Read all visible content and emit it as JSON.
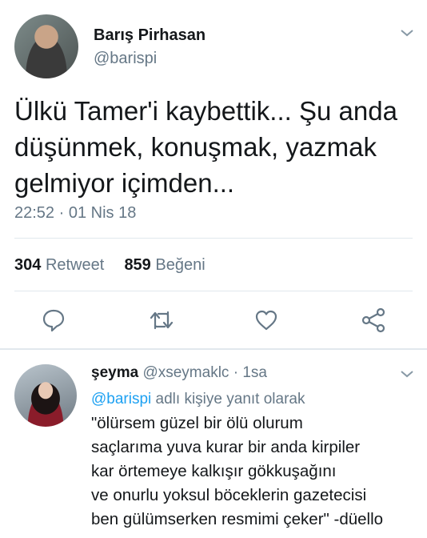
{
  "tweet": {
    "author_name": "Barış Pirhasan",
    "author_handle": "@barispi",
    "text_lines": [
      "Ülkü Tamer'i kaybettik... Şu anda",
      "düşünmek, konuşmak, yazmak",
      "gelmiyor içimden..."
    ],
    "time": "22:52",
    "separator": "·",
    "date": "01 Nis 18",
    "retweet_count": "304",
    "retweet_label": "Retweet",
    "like_count": "859",
    "like_label": "Beğeni"
  },
  "actions": [
    "reply-icon",
    "retweet-icon",
    "like-icon",
    "share-icon"
  ],
  "reply": {
    "author_name": "şeyma",
    "author_handle": "@xseymaklc",
    "separator": "·",
    "age": "1sa",
    "mention": "@barispi",
    "replying_suffix": "adlı kişiye yanıt olarak",
    "text_lines": [
      "\"ölürsem güzel bir ölü olurum",
      "saçlarıma yuva kurar bir anda kirpiler",
      "kar örtemeye kalkışır gökkuşağını",
      "ve onurlu yoksul böceklerin gazetecisi",
      "ben gülümserken resmimi çeker\" -düello"
    ]
  },
  "colors": {
    "text": "#14171a",
    "muted": "#657786",
    "link": "#1da1f2",
    "divider": "#e1e8ed"
  }
}
